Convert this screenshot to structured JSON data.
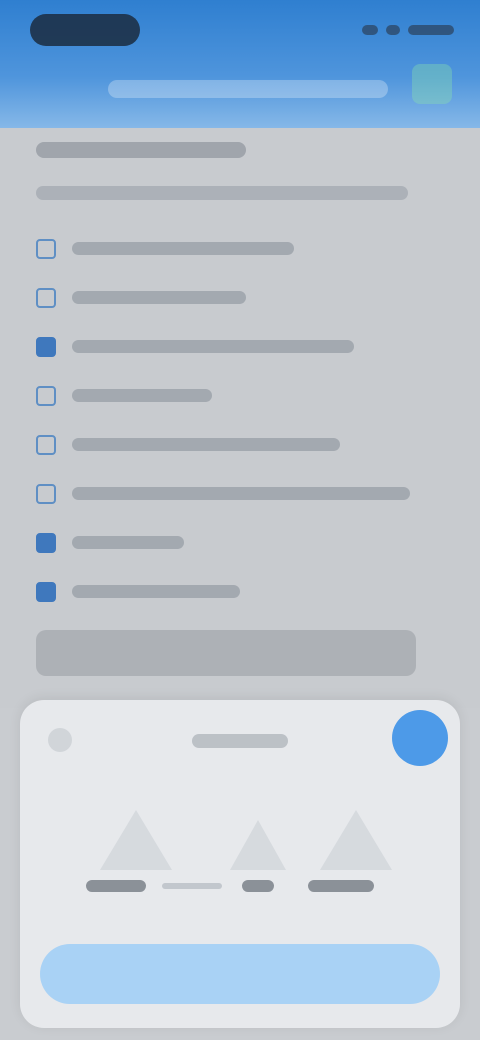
{
  "colors": {
    "header_top": "#2f7fd0",
    "header_bottom": "#86b8e8",
    "checkbox_border": "#5f8fc4",
    "checkbox_checked": "#3f78bd",
    "sheet_background": "#e7e9ec",
    "fab": "#4d9ae8",
    "cta": "#a9d2f5"
  },
  "header": {
    "status_bar_icons": [
      "signal-icon",
      "wifi-icon",
      "battery-icon"
    ],
    "action_icon": "action-icon"
  },
  "checklist": {
    "items": [
      {
        "checked": false
      },
      {
        "checked": false
      },
      {
        "checked": true
      },
      {
        "checked": false
      },
      {
        "checked": false
      },
      {
        "checked": false
      },
      {
        "checked": true
      },
      {
        "checked": true
      }
    ]
  },
  "sheet": {
    "back_icon": "back-icon",
    "fab_icon": "fab-icon",
    "options": [
      "option-1",
      "option-2",
      "option-3"
    ]
  }
}
